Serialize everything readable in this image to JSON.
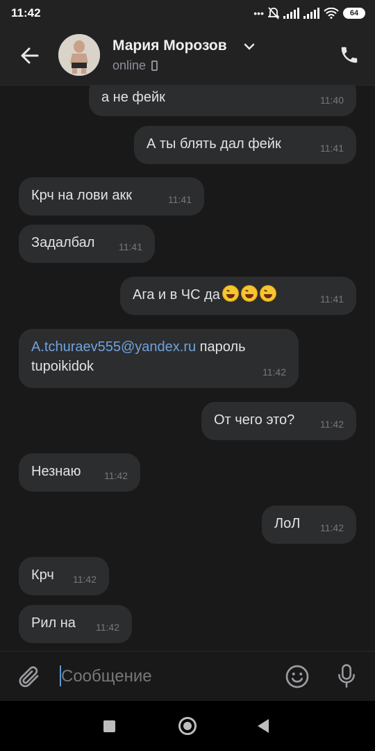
{
  "statusbar": {
    "time": "11:42",
    "battery": "64"
  },
  "header": {
    "name": "Мария Морозов",
    "status": "online"
  },
  "messages": [
    {
      "side": "in-top",
      "text": "а не фейк",
      "time": "11:40"
    },
    {
      "side": "out",
      "text": "А ты блять дал фейк",
      "time": "11:41"
    },
    {
      "side": "in",
      "text": "Крч на лови акк",
      "time": "11:41"
    },
    {
      "side": "in",
      "text": "Задалбал",
      "time": "11:41"
    },
    {
      "side": "out",
      "text": "Ага и в ЧС да",
      "emoji_count": 3,
      "time": "11:41"
    },
    {
      "side": "in",
      "link": "A.tchuraev555@yandex.ru",
      "text_after": " пароль",
      "line2": "tupoikidok",
      "time": "11:42"
    },
    {
      "side": "out",
      "text": "От чего это?",
      "time": "11:42"
    },
    {
      "side": "in",
      "text": "Незнаю",
      "time": "11:42"
    },
    {
      "side": "out",
      "text": "ЛоЛ",
      "time": "11:42"
    },
    {
      "side": "in",
      "text": "Крч",
      "time": "11:42"
    },
    {
      "side": "in",
      "text": "Рил на",
      "time": "11:42"
    }
  ],
  "composer": {
    "placeholder": "Сообщение"
  },
  "icons": {
    "back": "back-arrow-icon",
    "chevron": "chevron-down-icon",
    "call": "phone-icon",
    "attach": "paperclip-icon",
    "emoji": "smile-icon",
    "mic": "microphone-icon"
  },
  "colors": {
    "bubble": "#2c2d2e",
    "background": "#19191a",
    "link": "#6fa3e0"
  }
}
